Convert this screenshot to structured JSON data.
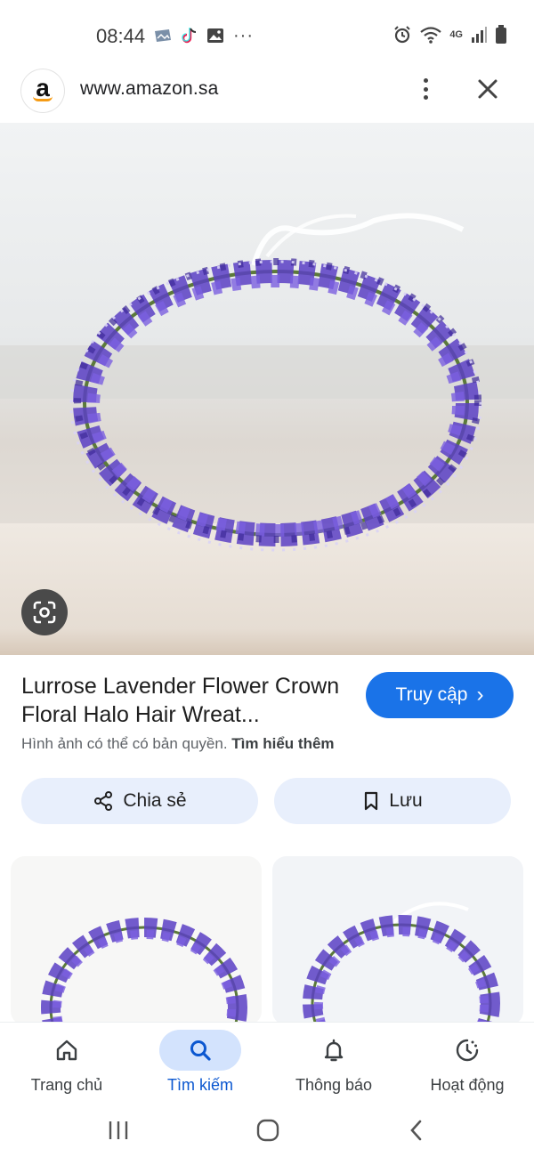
{
  "status_bar": {
    "time": "08:44",
    "left_icons": [
      "gallery-icon",
      "tiktok-icon",
      "image-icon",
      "more-dots-icon"
    ],
    "right_icons": [
      "alarm-icon",
      "wifi-icon",
      "4g-icon",
      "signal-icon",
      "battery-icon"
    ],
    "network_label": "4G",
    "more_label": "···"
  },
  "header": {
    "logo_letter": "a",
    "url": "www.amazon.sa"
  },
  "hero": {
    "lens_icon": "google-lens-icon",
    "subject": "lavender flower crown"
  },
  "product": {
    "title": "Lurrose Lavender Flower Crown Floral Halo Hair Wreat...",
    "visit_label": "Truy cập",
    "visit_chevron": "›",
    "copyright_text": "Hình ảnh có thể có bản quyền.",
    "learn_more": "Tìm hiểu thêm"
  },
  "actions": {
    "share_label": "Chia sẻ",
    "save_label": "Lưu"
  },
  "bottom_nav": {
    "items": [
      {
        "label": "Trang chủ",
        "icon": "home-icon",
        "active": false
      },
      {
        "label": "Tìm kiếm",
        "icon": "search-icon",
        "active": true
      },
      {
        "label": "Thông báo",
        "icon": "bell-icon",
        "active": false
      },
      {
        "label": "Hoạt động",
        "icon": "activity-icon",
        "active": false
      }
    ]
  },
  "colors": {
    "accent": "#1a73e8",
    "chip_bg": "#e8effc",
    "active_nav_bg": "#d3e3fd",
    "active_nav_text": "#0b57d0",
    "lavender": "#5b3fc4"
  }
}
